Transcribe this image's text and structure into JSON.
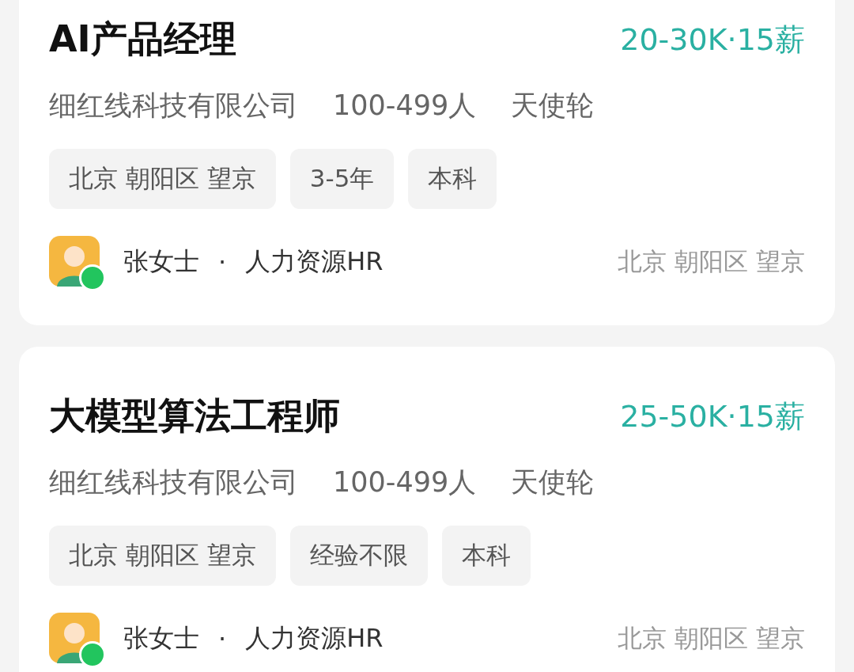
{
  "jobs": [
    {
      "title": "AI产品经理",
      "salary": "20-30K·15薪",
      "company": "细红线科技有限公司",
      "size": "100-499人",
      "funding": "天使轮",
      "tags": [
        "北京 朝阳区 望京",
        "3-5年",
        "本科"
      ],
      "recruiter": "张女士",
      "separator": "·",
      "recruiter_role": "人力资源HR",
      "online": true,
      "location": "北京 朝阳区 望京"
    },
    {
      "title": "大模型算法工程师",
      "salary": "25-50K·15薪",
      "company": "细红线科技有限公司",
      "size": "100-499人",
      "funding": "天使轮",
      "tags": [
        "北京 朝阳区 望京",
        "经验不限",
        "本科"
      ],
      "recruiter": "张女士",
      "separator": "·",
      "recruiter_role": "人力资源HR",
      "online": true,
      "location": "北京 朝阳区 望京"
    }
  ]
}
